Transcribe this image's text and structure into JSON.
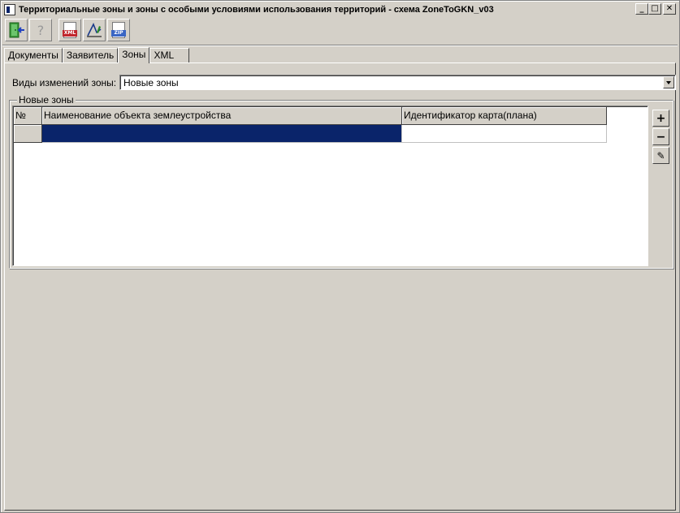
{
  "window": {
    "title": "Территориальные зоны и зоны с особыми условиями использования территорий  - схема ZoneToGKN_v03",
    "controls": {
      "minimize": "_",
      "maximize": "□",
      "close": "✕"
    }
  },
  "toolbar": {
    "buttons": [
      {
        "name": "exit",
        "icon": "door-exit-icon"
      },
      {
        "name": "help",
        "icon": "question-icon"
      },
      {
        "name": "xml",
        "icon": "xml-document-icon",
        "badge": "XML"
      },
      {
        "name": "sign",
        "icon": "signature-icon"
      },
      {
        "name": "zip",
        "icon": "zip-document-icon",
        "badge": "ZIP"
      }
    ]
  },
  "tabs": [
    {
      "label": "Документы",
      "active": false
    },
    {
      "label": "Заявитель",
      "active": false
    },
    {
      "label": "Зоны",
      "active": true
    },
    {
      "label": "XML",
      "active": false
    }
  ],
  "zone_change": {
    "label": "Виды изменений зоны:",
    "value": "Новые зоны"
  },
  "group": {
    "legend": "Новые зоны",
    "grid": {
      "columns": [
        "№",
        "Наименование объекта землеустройства",
        "Идентификатор карта(плана)"
      ],
      "rows": [
        [
          "",
          "",
          ""
        ]
      ]
    },
    "side_buttons": [
      {
        "name": "add",
        "glyph": "+"
      },
      {
        "name": "remove",
        "glyph": "−"
      },
      {
        "name": "edit",
        "glyph": "✎"
      }
    ]
  },
  "colors": {
    "face": "#d4d0c8",
    "selection": "#0a246a",
    "xml_badge": "#c0272d",
    "zip_badge": "#3a66c4"
  }
}
